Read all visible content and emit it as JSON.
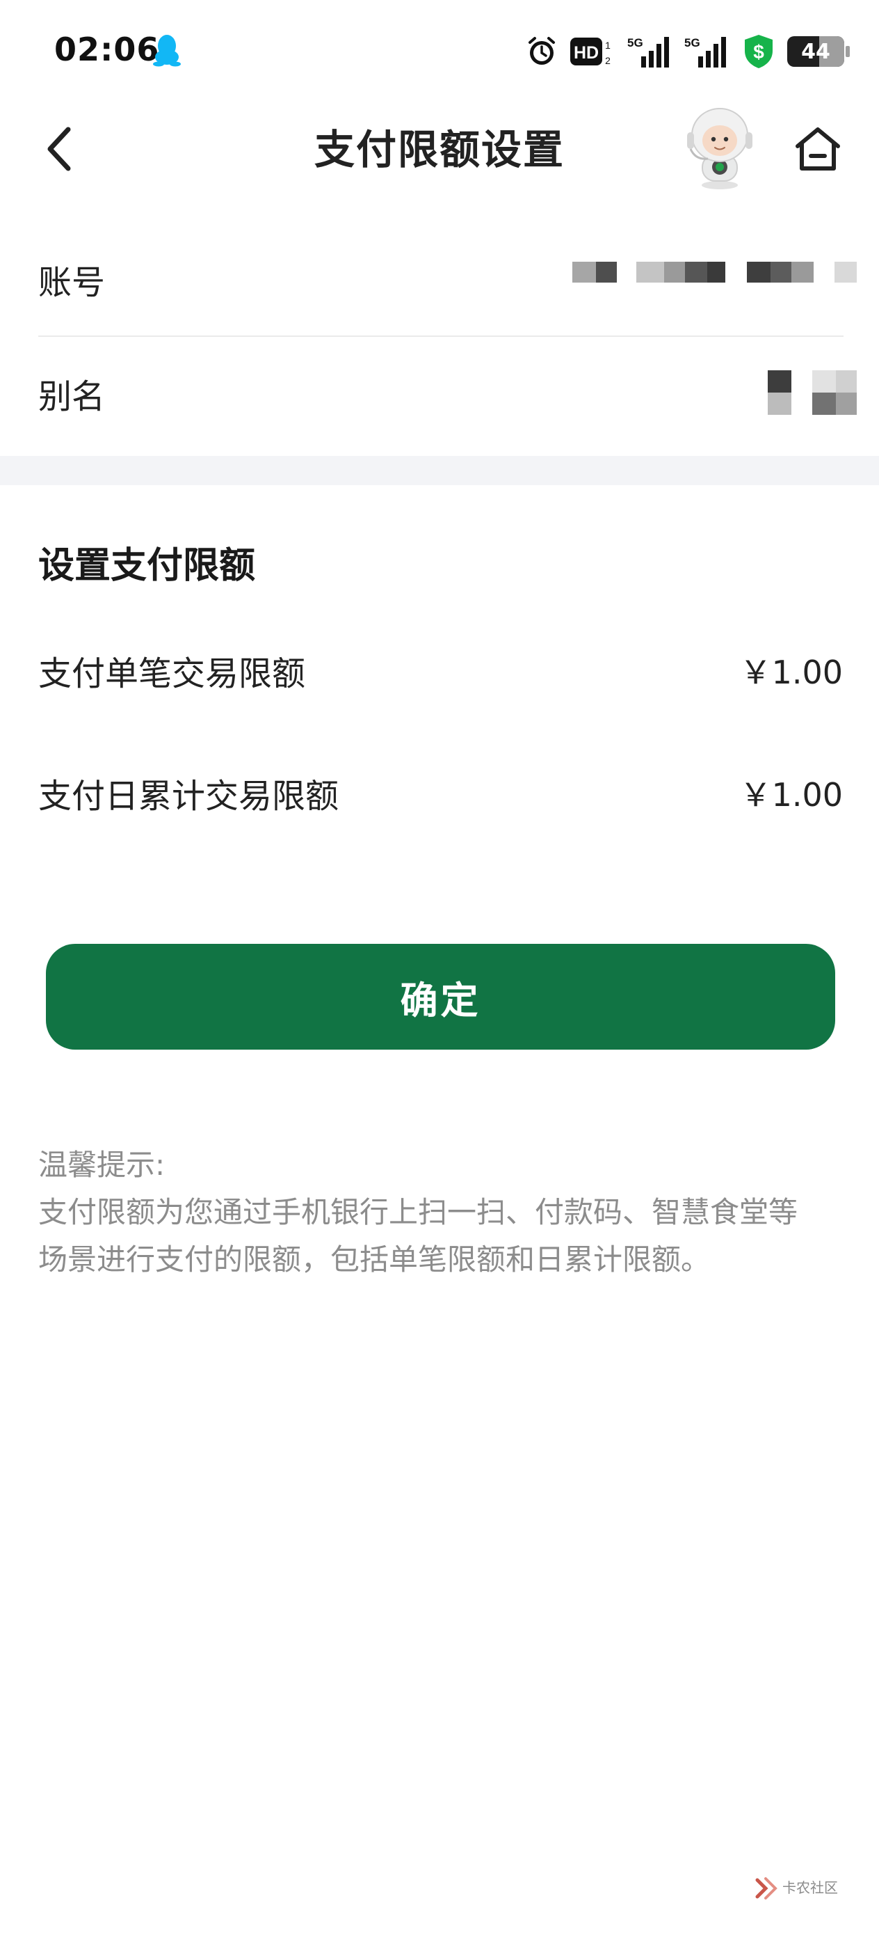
{
  "status_bar": {
    "time": "02:06",
    "hd_label": "HD",
    "sim1_label": "5G",
    "sim2_label": "5G",
    "battery": "44"
  },
  "nav": {
    "title": "支付限额设置"
  },
  "account": {
    "account_label": "账号",
    "alias_label": "别名"
  },
  "limits": {
    "section_title": "设置支付限额",
    "single_label": "支付单笔交易限额",
    "single_value": "￥1.00",
    "daily_label": "支付日累计交易限额",
    "daily_value": "￥1.00"
  },
  "confirm_button": "确定",
  "tips": {
    "heading": "温馨提示:",
    "line1": "支付限额为您通过手机银行上扫一扫、付款码、智慧食堂等",
    "line2": "场景进行支付的限额，包括单笔限额和日累计限额。"
  },
  "watermark": {
    "text": "卡农社区"
  },
  "colors": {
    "primary_green": "#117444",
    "qq_blue": "#12b7f5",
    "shield_green": "#16b34a"
  }
}
